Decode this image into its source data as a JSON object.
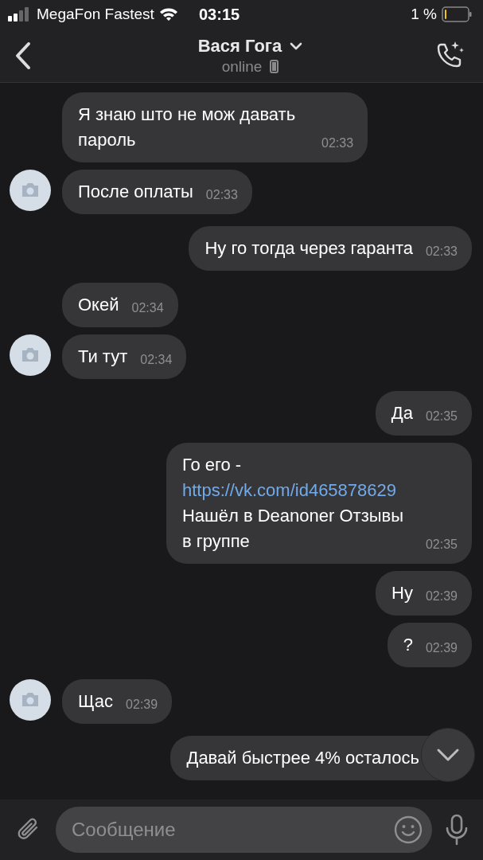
{
  "status_bar": {
    "carrier": "MegaFon Fastest",
    "time": "03:15",
    "battery": "1 %"
  },
  "header": {
    "name": "Вася Гога",
    "status": "online"
  },
  "messages": [
    {
      "kind": "incoming",
      "avatar": false,
      "parts": [
        {
          "kind": "text",
          "text": "Я знаю што не мож давать пароль"
        }
      ],
      "time": "02:33"
    },
    {
      "kind": "incoming",
      "avatar": true,
      "parts": [
        {
          "kind": "text",
          "text": "После оплаты"
        }
      ],
      "time": "02:33"
    },
    {
      "kind": "outgoing",
      "parts": [
        {
          "kind": "text",
          "text": "Ну го тогда через гаранта"
        }
      ],
      "time": "02:33"
    },
    {
      "kind": "incoming",
      "avatar": false,
      "parts": [
        {
          "kind": "text",
          "text": "Окей"
        }
      ],
      "time": "02:34"
    },
    {
      "kind": "incoming",
      "avatar": true,
      "parts": [
        {
          "kind": "text",
          "text": "Ти тут"
        }
      ],
      "time": "02:34"
    },
    {
      "kind": "outgoing",
      "parts": [
        {
          "kind": "text",
          "text": "Да"
        }
      ],
      "time": "02:35"
    },
    {
      "kind": "outgoing",
      "parts": [
        {
          "kind": "text",
          "text": "Го его - "
        },
        {
          "kind": "link",
          "text": "https://vk.com/id465878629"
        },
        {
          "kind": "text",
          "text": " Нашёл в Deanoner Отзывы в группе"
        }
      ],
      "time": "02:35"
    },
    {
      "kind": "outgoing",
      "parts": [
        {
          "kind": "text",
          "text": "Ну"
        }
      ],
      "time": "02:39"
    },
    {
      "kind": "outgoing",
      "parts": [
        {
          "kind": "text",
          "text": "?"
        }
      ],
      "time": "02:39"
    },
    {
      "kind": "incoming",
      "avatar": true,
      "parts": [
        {
          "kind": "text",
          "text": "Щас"
        }
      ],
      "time": "02:39"
    },
    {
      "kind": "outgoing",
      "parts": [
        {
          "kind": "text",
          "text": "Давай быстрее 4% осталось"
        }
      ]
    }
  ],
  "composer": {
    "placeholder": "Сообщение"
  }
}
